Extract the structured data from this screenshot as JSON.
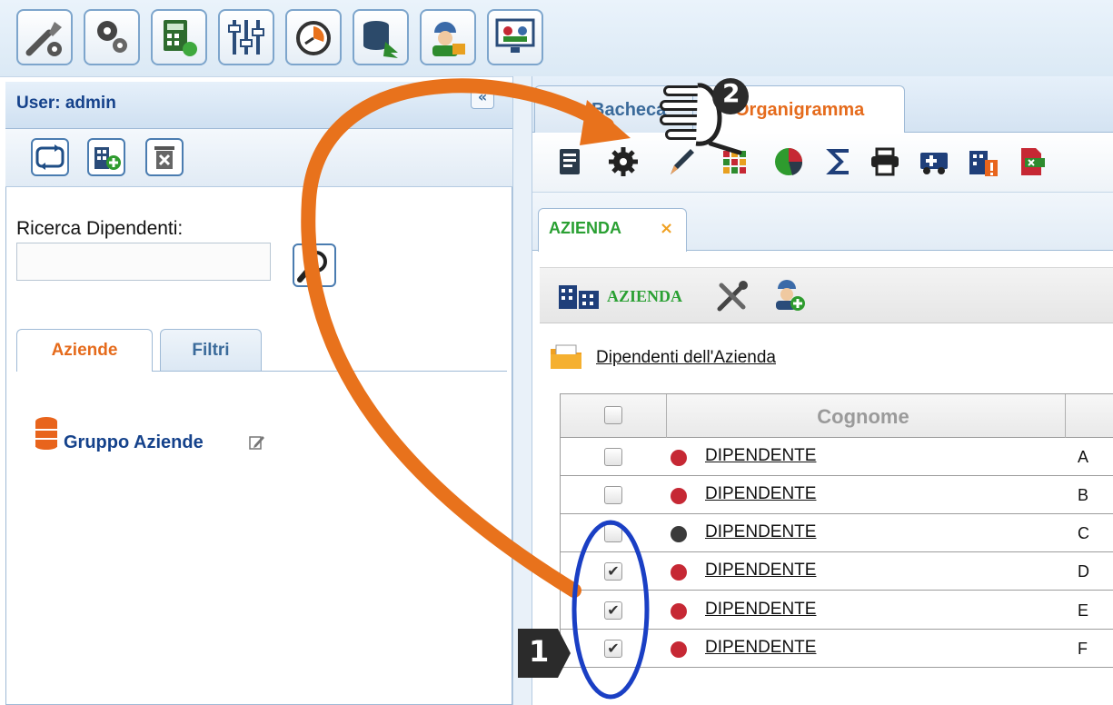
{
  "top_toolbar": {
    "buttons": [
      {
        "name": "tools-settings-icon"
      },
      {
        "name": "gears-settings-icon"
      },
      {
        "name": "calculator-icon"
      },
      {
        "name": "sliders-icon"
      },
      {
        "name": "timer-icon"
      },
      {
        "name": "database-export-icon"
      },
      {
        "name": "worker-lock-icon"
      },
      {
        "name": "monitor-users-icon"
      }
    ]
  },
  "left_panel": {
    "title": "User: admin",
    "collapse_label": "«",
    "search_label": "Ricerca Dipendenti:",
    "search_value": "",
    "tabs": [
      "Aziende",
      "Filtri"
    ],
    "group_label": "Gruppo Aziende"
  },
  "right_panel": {
    "tabs": [
      "Bacheca",
      "Organigramma"
    ],
    "inner_tab": "AZIENDA",
    "azienda_toolbar_label": "AZIENDA",
    "employees_link": "Dipendenti dell'Azienda",
    "grid": {
      "header": "Cognome",
      "rows": [
        {
          "name": "DIPENDENTE",
          "letter": "A",
          "checked": false,
          "status_color": "#c62834"
        },
        {
          "name": "DIPENDENTE",
          "letter": "B",
          "checked": false,
          "status_color": "#c62834"
        },
        {
          "name": "DIPENDENTE",
          "letter": "C",
          "checked": false,
          "status_color": "#3a3a3a"
        },
        {
          "name": "DIPENDENTE",
          "letter": "D",
          "checked": true,
          "status_color": "#c62834"
        },
        {
          "name": "DIPENDENTE",
          "letter": "E",
          "checked": true,
          "status_color": "#c62834"
        },
        {
          "name": "DIPENDENTE",
          "letter": "F",
          "checked": true,
          "status_color": "#c62834"
        }
      ]
    }
  },
  "annotations": {
    "step1": "1",
    "step2": "2",
    "arrow_color": "#e8721c",
    "ellipse_color": "#1a3fc4"
  },
  "colors": {
    "accent_orange": "#e56b1c",
    "accent_green": "#2aa033",
    "header_blue": "#15428b"
  }
}
